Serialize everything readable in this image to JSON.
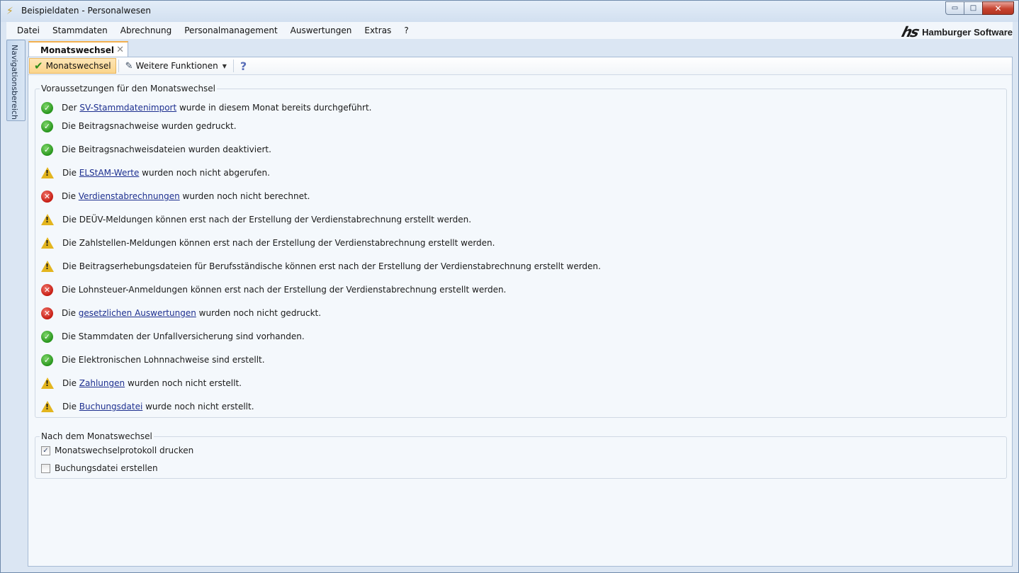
{
  "window": {
    "title": "Beispieldaten - Personalwesen",
    "buttons": {
      "minimize": "▭",
      "maximize": "□",
      "close": "✕"
    }
  },
  "menu": {
    "items": [
      "Datei",
      "Stammdaten",
      "Abrechnung",
      "Personalmanagement",
      "Auswertungen",
      "Extras",
      "?"
    ],
    "brand_logo": "hs",
    "brand_text": "Hamburger Software"
  },
  "navigation": {
    "label": "Navigationsbereich"
  },
  "tab": {
    "label": "Monatswechsel",
    "close": "✕"
  },
  "toolbar": {
    "monatswechsel_label": "Monatswechsel",
    "weitere_label": "Weitere Funktionen",
    "help_icon": "?"
  },
  "prerequisites": {
    "title": "Voraussetzungen für den Monatswechsel",
    "items": [
      {
        "status": "ok",
        "pre": "Der ",
        "link": "SV-Stammdatenimport",
        "post": " wurde in diesem Monat bereits durchgeführt."
      },
      {
        "status": "ok",
        "pre": "Die Beitragsnachweise wurden gedruckt.",
        "link": "",
        "post": ""
      },
      {
        "status": "ok",
        "pre": "Die Beitragsnachweisdateien wurden deaktiviert.",
        "link": "",
        "post": ""
      },
      {
        "status": "warn",
        "pre": "Die ",
        "link": "ELStAM-Werte",
        "post": " wurden noch nicht abgerufen."
      },
      {
        "status": "error",
        "pre": "Die ",
        "link": "Verdienstabrechnungen",
        "post": " wurden noch nicht berechnet."
      },
      {
        "status": "warn",
        "pre": "Die DEÜV-Meldungen können erst nach der Erstellung der Verdienstabrechnung erstellt werden.",
        "link": "",
        "post": ""
      },
      {
        "status": "warn",
        "pre": "Die Zahlstellen-Meldungen können erst nach der Erstellung der Verdienstabrechnung erstellt werden.",
        "link": "",
        "post": ""
      },
      {
        "status": "warn",
        "pre": "Die Beitragserhebungsdateien für Berufsständische können erst nach der Erstellung der Verdienstabrechnung erstellt werden.",
        "link": "",
        "post": ""
      },
      {
        "status": "error",
        "pre": "Die Lohnsteuer-Anmeldungen können erst nach der Erstellung der Verdienstabrechnung erstellt werden.",
        "link": "",
        "post": ""
      },
      {
        "status": "error",
        "pre": "Die ",
        "link": "gesetzlichen Auswertungen",
        "post": " wurden noch nicht gedruckt."
      },
      {
        "status": "ok",
        "pre": "Die Stammdaten der Unfallversicherung sind vorhanden.",
        "link": "",
        "post": ""
      },
      {
        "status": "ok",
        "pre": "Die Elektronischen Lohnnachweise sind erstellt.",
        "link": "",
        "post": ""
      },
      {
        "status": "warn",
        "pre": "Die ",
        "link": "Zahlungen",
        "post": " wurden noch nicht erstellt."
      },
      {
        "status": "warn",
        "pre": "Die ",
        "link": "Buchungsdatei",
        "post": " wurde noch nicht erstellt."
      }
    ]
  },
  "after": {
    "title": "Nach dem Monatswechsel",
    "options": [
      {
        "label": "Monatswechselprotokoll drucken",
        "checked": true
      },
      {
        "label": "Buchungsdatei erstellen",
        "checked": false
      }
    ]
  },
  "colors": {
    "ok": "#27941c",
    "error": "#c51c12",
    "warn": "#e3b51e",
    "link": "#1d2f8f",
    "tab_accent": "#f3b04f"
  }
}
